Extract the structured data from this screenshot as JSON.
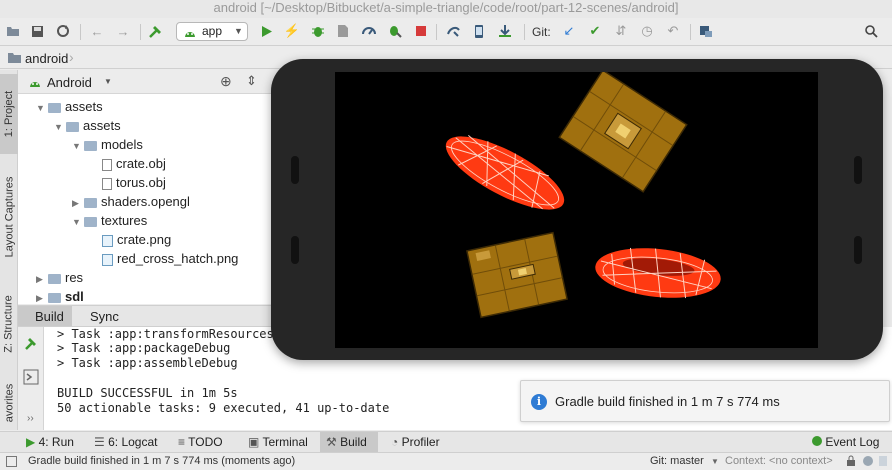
{
  "window": {
    "title": "android [~/Desktop/Bitbucket/a-simple-triangle/code/root/part-12-scenes/android]"
  },
  "toolbar": {
    "run_config": "app",
    "git_label": "Git:"
  },
  "breadcrumb": {
    "root": "android"
  },
  "left_strip": {
    "project_tab": "1: Project",
    "captures_tab": "Layout Captures",
    "structure_tab": "Z: Structure",
    "favorites_tab": "avorites"
  },
  "project": {
    "view_selector": "Android",
    "tree": [
      {
        "label": "assets",
        "depth": 0,
        "expanded": true,
        "kind": "folder"
      },
      {
        "label": "assets",
        "depth": 1,
        "expanded": true,
        "kind": "folder"
      },
      {
        "label": "models",
        "depth": 2,
        "expanded": true,
        "kind": "folder"
      },
      {
        "label": "crate.obj",
        "depth": 3,
        "kind": "file"
      },
      {
        "label": "torus.obj",
        "depth": 3,
        "kind": "file"
      },
      {
        "label": "shaders.opengl",
        "depth": 2,
        "expanded": false,
        "kind": "folder"
      },
      {
        "label": "textures",
        "depth": 2,
        "expanded": true,
        "kind": "folder"
      },
      {
        "label": "crate.png",
        "depth": 3,
        "kind": "image"
      },
      {
        "label": "red_cross_hatch.png",
        "depth": 3,
        "kind": "image"
      },
      {
        "label": "res",
        "depth": 0,
        "expanded": false,
        "kind": "folder"
      },
      {
        "label": "sdl",
        "depth": 0,
        "expanded": false,
        "kind": "folder"
      }
    ]
  },
  "build_panel": {
    "tabs": [
      "Build",
      "Sync"
    ],
    "console": [
      "> Task :app:transformResourcesW",
      "> Task :app:packageDebug",
      "> Task :app:assembleDebug",
      "",
      "BUILD SUCCESSFUL in 1m 5s",
      "50 actionable tasks: 9 executed, 41 up-to-date"
    ]
  },
  "notification": {
    "text": "Gradle build finished in 1 m 7 s 774 ms"
  },
  "bottom_tabs": {
    "run": "4: Run",
    "logcat": "6: Logcat",
    "todo": "TODO",
    "terminal": "Terminal",
    "build": "Build",
    "profiler": "Profiler",
    "event_log": "Event Log"
  },
  "status": {
    "message": "Gradle build finished in 1 m 7 s 774 ms (moments ago)",
    "git_branch": "Git: master",
    "context": "Context: <no context>"
  },
  "colors": {
    "accent_green": "#3c9a2e",
    "torus_red": "#ff3a12",
    "crate_brown": "#a0700f",
    "info_blue": "#2e7bd4"
  }
}
